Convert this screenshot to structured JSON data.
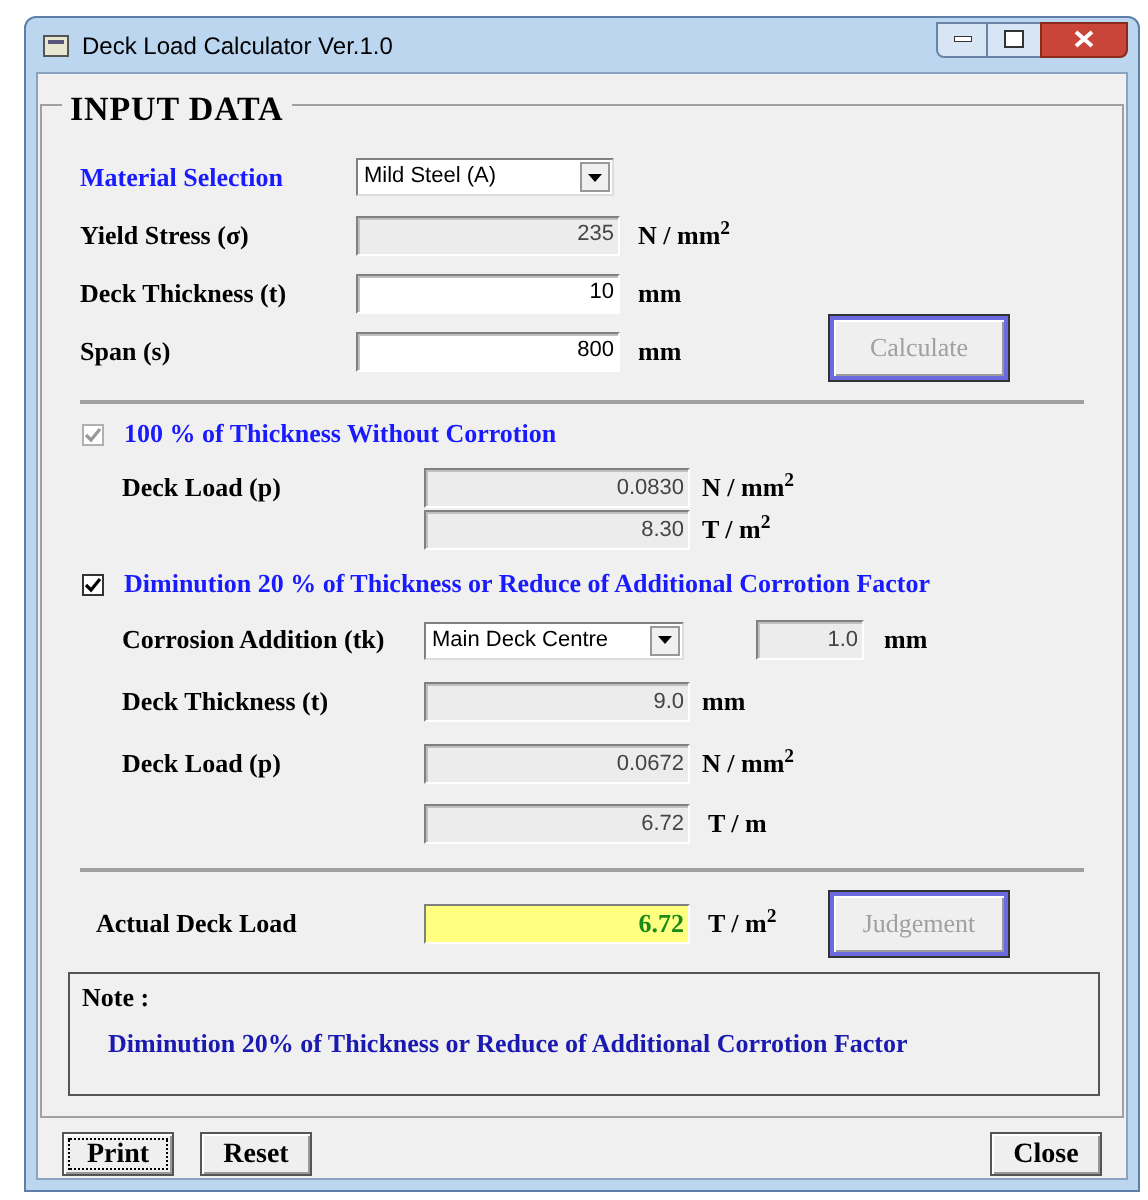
{
  "window": {
    "title": "Deck Load Calculator Ver.1.0"
  },
  "input_data": {
    "title": "INPUT DATA",
    "material": {
      "label": "Material Selection",
      "value": "Mild Steel (A)"
    },
    "yield_stress": {
      "label": "Yield Stress  (σ)",
      "value": "235",
      "unit": "N / mm$^{2}$",
      "readonly": true
    },
    "deck_thickness": {
      "label": "Deck Thickness (t)",
      "value": "10",
      "unit": "mm",
      "readonly": false
    },
    "span": {
      "label": "Span (s)",
      "value": "800",
      "unit": "mm",
      "readonly": false
    },
    "calculate_button": {
      "label": "Calculate",
      "disabled": true
    }
  },
  "without_corrosion": {
    "label": "100 % of Thickness Without Corrotion",
    "checked": true,
    "disabled": true,
    "deck_load": {
      "label": "Deck Load (p)",
      "rows": [
        {
          "value": "0.0830",
          "unit": "N / mm$^{2}$"
        },
        {
          "value": "8.30",
          "unit": "T / m$^{2}$"
        }
      ]
    }
  },
  "diminution": {
    "label": "Diminution 20 % of Thickness or Reduce of Additional Corrotion Factor",
    "checked": true,
    "disabled": false,
    "corrosion": {
      "label": "Corrosion Addition (tk)",
      "value": "Main Deck Centre",
      "addition": "1.0",
      "unit": "mm"
    },
    "deck_thickness": {
      "label": "Deck Thickness (t)",
      "value": "9.0",
      "unit": "mm"
    },
    "deck_load": {
      "label": "Deck Load (p)",
      "rows": [
        {
          "value": "0.0672",
          "unit": "N / mm$^{2}$"
        },
        {
          "value": "6.72",
          "unit": "T / m"
        }
      ]
    }
  },
  "actual": {
    "label": "Actual Deck Load",
    "value": "6.72",
    "unit": "T / m$^{2}$"
  },
  "judgement_button": {
    "label": "Judgement",
    "disabled": true
  },
  "note": {
    "title": "Note :",
    "text": "Diminution 20% of Thickness or Reduce of Additional Corrotion Factor"
  },
  "buttons": [
    {
      "label": "Print",
      "focused": true
    },
    {
      "label": "Reset",
      "focused": false
    },
    {
      "label": "Close",
      "focused": false
    }
  ]
}
